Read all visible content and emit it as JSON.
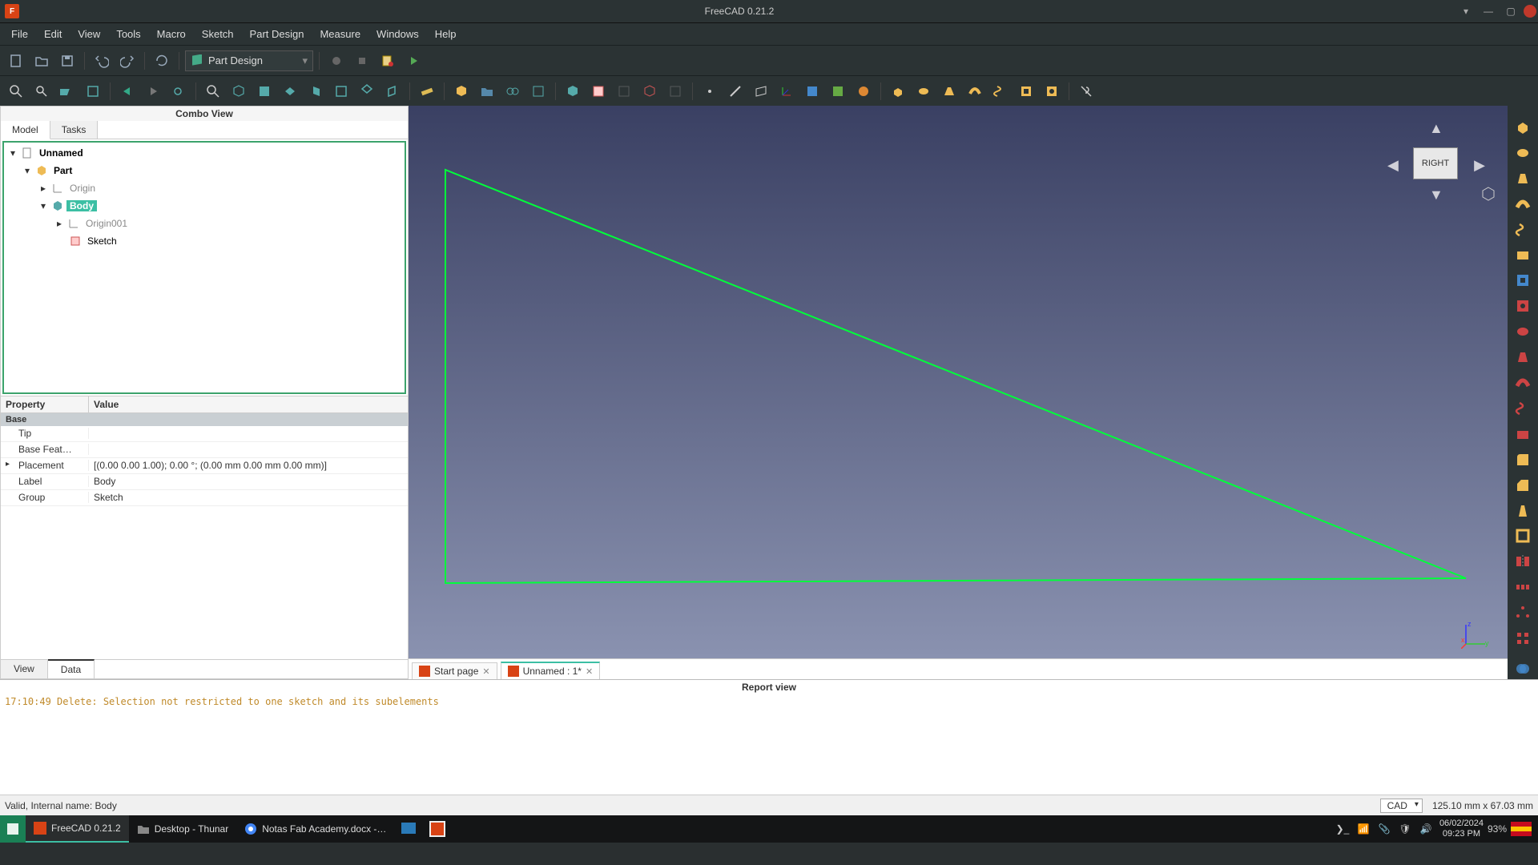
{
  "titlebar": {
    "app": "F",
    "title": "FreeCAD 0.21.2"
  },
  "menu": [
    "File",
    "Edit",
    "View",
    "Tools",
    "Macro",
    "Sketch",
    "Part Design",
    "Measure",
    "Windows",
    "Help"
  ],
  "workbench": "Part Design",
  "combo": {
    "title": "Combo View",
    "tabs": [
      "Model",
      "Tasks"
    ],
    "active": 0,
    "bottom_tabs": [
      "View",
      "Data"
    ],
    "bottom_active": 1
  },
  "tree": {
    "root": "Unnamed",
    "part": "Part",
    "origin": "Origin",
    "body": "Body",
    "origin001": "Origin001",
    "sketch": "Sketch"
  },
  "props": {
    "header_k": "Property",
    "header_v": "Value",
    "group": "Base",
    "rows": [
      {
        "k": "Tip",
        "v": ""
      },
      {
        "k": "Base Feat…",
        "v": ""
      },
      {
        "k": "Placement",
        "v": "[(0.00 0.00 1.00); 0.00 °; (0.00 mm  0.00 mm  0.00 mm)]",
        "exp": true
      },
      {
        "k": "Label",
        "v": "Body"
      },
      {
        "k": "Group",
        "v": "Sketch"
      }
    ]
  },
  "navcube": "RIGHT",
  "doc_tabs": [
    {
      "label": "Start page",
      "active": false
    },
    {
      "label": "Unnamed : 1*",
      "active": true
    }
  ],
  "report": {
    "title": "Report view",
    "line": "17:10:49  Delete: Selection not restricted to one sketch and its subelements"
  },
  "status": {
    "msg": "Valid, Internal name: Body",
    "navstyle": "CAD",
    "dims": "125.10 mm x 67.03 mm"
  },
  "taskbar": {
    "apps": [
      {
        "label": "FreeCAD 0.21.2",
        "active": true,
        "icon": "freecad"
      },
      {
        "label": "Desktop - Thunar",
        "active": false,
        "icon": "folder"
      },
      {
        "label": "Notas Fab Academy.docx -…",
        "active": false,
        "icon": "chrome"
      }
    ],
    "date": "06/02/2024",
    "time": "09:23 PM",
    "battery": "93%"
  }
}
